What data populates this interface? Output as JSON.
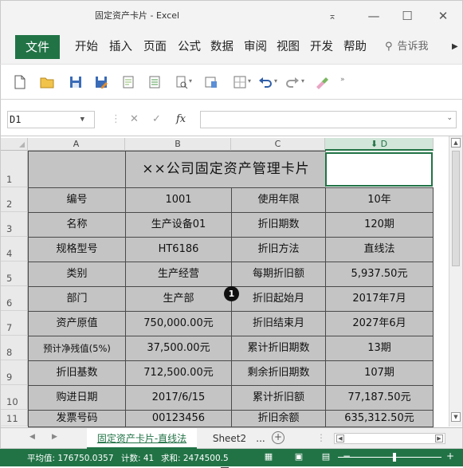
{
  "window": {
    "title": "固定资产卡片 - Excel",
    "controls": {
      "ribbon_display": "⌅",
      "minimize": "—",
      "maximize": "☐",
      "close": "✕"
    }
  },
  "menu": {
    "file": "文件",
    "items": [
      "开始",
      "插入",
      "页面",
      "公式",
      "数据",
      "审阅",
      "视图",
      "开发",
      "帮助"
    ],
    "tell_me": "告诉我",
    "tell_me_icon": "lightbulb-icon",
    "more": "▶"
  },
  "toolbar": {
    "icons": [
      "new-file-icon",
      "open-folder-icon",
      "save-icon",
      "save-as-icon",
      "print-preview-icon",
      "print-icon",
      "preview-icon",
      "format-painter-icon",
      "borders-icon",
      "undo-icon",
      "redo-icon",
      "clear-icon",
      "more-icon"
    ]
  },
  "formula_bar": {
    "name_box": "D1",
    "cancel": "✕",
    "enter": "✓",
    "fx": "fx",
    "value": ""
  },
  "sheet": {
    "columns": [
      "A",
      "B",
      "C",
      "D"
    ],
    "selected_column": "D",
    "rows": [
      "1",
      "2",
      "3",
      "4",
      "5",
      "6",
      "7",
      "8",
      "9",
      "10",
      "11"
    ],
    "title": "××公司固定资产管理卡片",
    "cells": [
      [
        "编号",
        "1001",
        "使用年限",
        "10年"
      ],
      [
        "名称",
        "生产设备01",
        "折旧期数",
        "120期"
      ],
      [
        "规格型号",
        "HT6186",
        "折旧方法",
        "直线法"
      ],
      [
        "类别",
        "生产经营",
        "每期折旧额",
        "5,937.50元"
      ],
      [
        "部门",
        "生产部",
        "折旧起始月",
        "2017年7月"
      ],
      [
        "资产原值",
        "750,000.00元",
        "折旧结束月",
        "2027年6月"
      ],
      [
        "预计净残值(5%)",
        "37,500.00元",
        "累计折旧期数",
        "13期"
      ],
      [
        "折旧基数",
        "712,500.00元",
        "剩余折旧期数",
        "107期"
      ],
      [
        "购进日期",
        "2017/6/15",
        "累计折旧额",
        "77,187.50元"
      ],
      [
        "发票号码",
        "00123456",
        "折旧余额",
        "635,312.50元"
      ]
    ],
    "badge": "1"
  },
  "tabs": {
    "nav_prev": "◀",
    "nav_next": "▶",
    "sheets": [
      "固定资产卡片-直线法",
      "Sheet2"
    ],
    "more": "...",
    "add": "+"
  },
  "status": {
    "average": "平均值: 176750.0357",
    "count": "计数: 41",
    "sum": "求和: 2474500.5",
    "zoom_minus": "−",
    "zoom_plus": "+"
  },
  "colors": {
    "accent": "#217346",
    "cell_fill": "#c4c4c4"
  }
}
